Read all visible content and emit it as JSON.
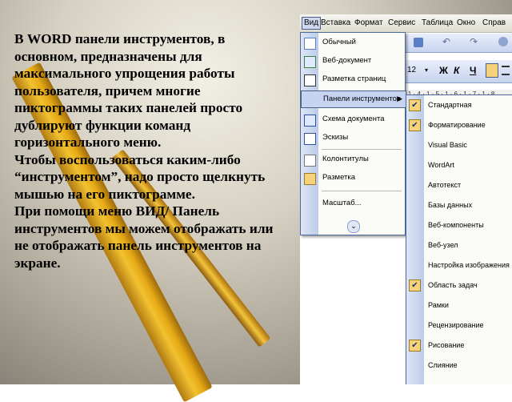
{
  "slide": {
    "paragraphs": [
      "В  WORD панели инструментов, в основном, предназначены для максимального упрощения работы пользователя, причем многие пиктограммы таких панелей просто дублируют функции команд горизонтального меню.",
      "Чтобы воспользоваться каким-либо “инструментом”, надо просто щелкнуть мышью на его пиктограмме.",
      "При помощи меню ВИД/ Панель инструментов мы можем отображать или не отображать панель инструментов на экране."
    ]
  },
  "menubar": {
    "items": [
      "Вид",
      "Вставка",
      "Формат",
      "Сервис",
      "Таблица",
      "Окно",
      "Справ"
    ]
  },
  "toolbar": {
    "font_size": "12",
    "bold": "Ж",
    "italic": "К",
    "underline": "Ч"
  },
  "ruler": {
    "text": "· 1 · 4 · 1 · 5 · 1 · 6 · 1 · 7 · 1 · 8"
  },
  "view_menu": {
    "items": [
      {
        "label": "Обычный",
        "icon": "normal-view-icon"
      },
      {
        "label": "Веб-документ",
        "icon": "web-layout-icon"
      },
      {
        "label": "Разметка страниц",
        "icon": "page-layout-icon"
      },
      {
        "label": "Панели инструментов",
        "icon": "",
        "submenu": true
      },
      {
        "label": "Схема документа",
        "icon": "document-map-icon"
      },
      {
        "label": "Эскизы",
        "icon": "thumbnails-icon"
      },
      {
        "label": "Колонтитулы",
        "icon": "header-footer-icon"
      },
      {
        "label": "Разметка",
        "icon": "markup-icon"
      },
      {
        "label": "Масштаб...",
        "icon": ""
      }
    ],
    "expand_glyph": "⌄"
  },
  "toolbars_submenu": {
    "items": [
      {
        "label": "Стандартная",
        "checked": true
      },
      {
        "label": "Форматирование",
        "checked": true
      },
      {
        "label": "Visual Basic",
        "checked": false
      },
      {
        "label": "WordArt",
        "checked": false
      },
      {
        "label": "Автотекст",
        "checked": false
      },
      {
        "label": "Базы данных",
        "checked": false
      },
      {
        "label": "Веб-компоненты",
        "checked": false
      },
      {
        "label": "Веб-узел",
        "checked": false
      },
      {
        "label": "Настройка изображения",
        "checked": false
      },
      {
        "label": "Область задач",
        "checked": true
      },
      {
        "label": "Рамки",
        "checked": false
      },
      {
        "label": "Рецензирование",
        "checked": false
      },
      {
        "label": "Рисование",
        "checked": true
      },
      {
        "label": "Слияние",
        "checked": false
      }
    ],
    "check_glyph": "✔"
  },
  "colors": {
    "menu_highlight": "#c6d4f2",
    "menu_border": "#4c6a9e",
    "check_bg": "#f6d27a"
  }
}
